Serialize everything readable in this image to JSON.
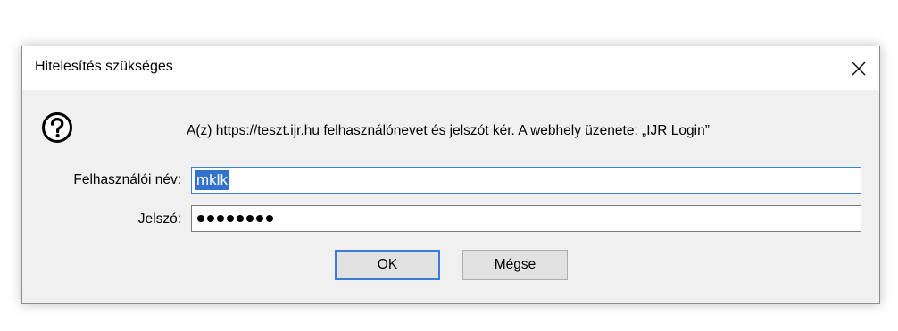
{
  "dialog": {
    "title": "Hitelesítés szükséges",
    "close_icon": "close-icon",
    "help_icon": "help-icon",
    "message": "A(z) https://teszt.ijr.hu felhasználónevet és jelszót kér. A webhely üzenete: „IJR Login”",
    "username_label": "Felhasználói név:",
    "username_value": "mklk",
    "password_label": "Jelszó:",
    "password_mask_length": 8,
    "ok_label": "OK",
    "cancel_label": "Mégse"
  },
  "colors": {
    "focus_border": "#3c7fd4",
    "selection": "#3272cf",
    "dialog_bg": "#f0f0f0"
  }
}
